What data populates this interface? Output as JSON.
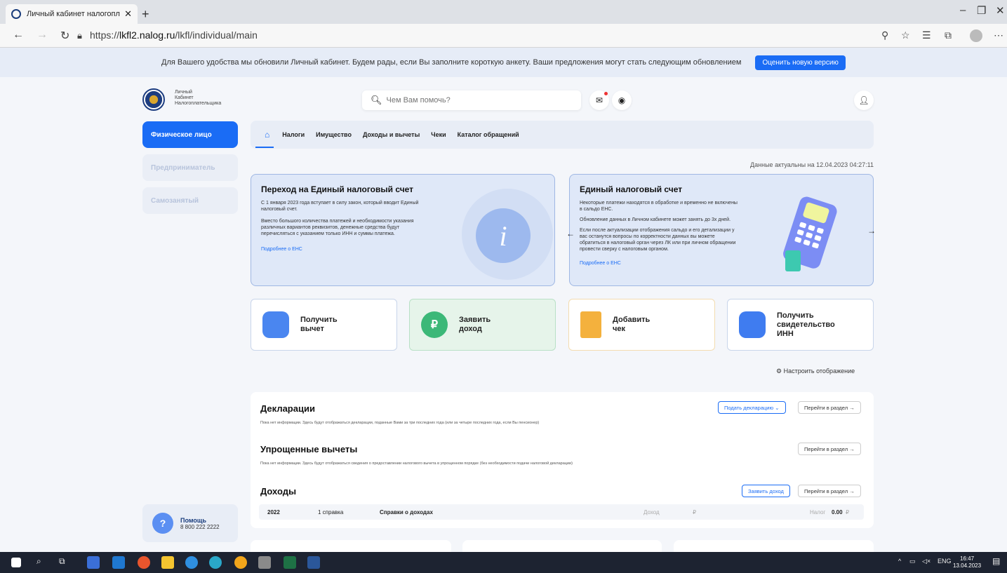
{
  "browser": {
    "tab_title": "Личный кабинет налогоплательщика",
    "url_prefix": "https://",
    "url_domain": "lkfl2.nalog.ru",
    "url_path": "/lkfl/individual/main"
  },
  "banner": {
    "text": "Для Вашего удобства мы обновили Личный кабинет. Будем рады, если Вы заполните короткую анкету. Ваши предложения могут стать следующим обновлением",
    "button": "Оценить новую версию"
  },
  "header": {
    "logo_line1": "Личный",
    "logo_line2": "Кабинет",
    "logo_line3": "Налогоплательщика",
    "search_placeholder": "Чем Вам помочь?"
  },
  "sidebar": {
    "items": [
      {
        "label": "Физическое лицо",
        "active": true
      },
      {
        "label": "Предприниматель",
        "active": false
      },
      {
        "label": "Самозанятый",
        "active": false
      }
    ],
    "help_title": "Помощь",
    "help_phone": "8 800 222 2222"
  },
  "menu": {
    "items": [
      "Налоги",
      "Имущество",
      "Доходы и вычеты",
      "Чеки",
      "Каталог обращений"
    ]
  },
  "updated": "Данные актуальны на 12.04.2023 04:27:11",
  "info_cards": [
    {
      "title": "Переход на Единый налоговый счет",
      "p1": "С 1 января 2023 года вступает в силу закон, который вводит Единый налоговый счет.",
      "p2": "Вместо большого количества платежей и необходимости указания различных вариантов реквизитов, денежные средства будут перечисляться с указанием только ИНН и суммы платежа.",
      "link": "Подробнее о ЕНС"
    },
    {
      "title": "Единый налоговый счет",
      "p1": "Некоторые платежи находятся в обработке и временно не включены в сальдо ЕНС.",
      "p2": "Обновление данных в Личном кабинете может занять до 3х дней.",
      "p3": "Если после актуализации отображения сальдо и его детализации у вас останутся вопросы по корректности данных вы можете обратиться в налоговый орган через ЛК или при личном обращении провести сверку с налоговым органом.",
      "link": "Подробнее о ЕНС"
    }
  ],
  "actions": [
    {
      "label": "Получить\nвычет",
      "color": "#4a86f0",
      "bg": "#ffffff",
      "border": "#c8d5ea"
    },
    {
      "label": "Заявить\nдоход",
      "color": "#3cb878",
      "bg": "#e6f4ea",
      "border": "#b9e0c6"
    },
    {
      "label": "Добавить\nчек",
      "color": "#f4b13d",
      "bg": "#ffffff",
      "border": "#f3dcb0"
    },
    {
      "label": "Получить\nсвидетельство\nИНН",
      "color": "#3f7cf0",
      "bg": "#ffffff",
      "border": "#c8d5ea"
    }
  ],
  "configure_label": "Настроить отображение",
  "sections": {
    "declarations": {
      "title": "Декларации",
      "note": "Пока нет информации. Здесь будут отображаться декларации, поданные Вами за три последних года (или за четыре последних года, если Вы пенсионер)",
      "btn_primary": "Подать декларацию ⌄",
      "btn_go": "Перейти в раздел →"
    },
    "simplified": {
      "title": "Упрощенные вычеты",
      "note": "Пока нет информации. Здесь будут отображаться сведения о предоставлении налогового вычета в упрощенном порядке (без необходимости подачи налоговой декларации)",
      "btn_go": "Перейти в раздел →"
    },
    "income": {
      "title": "Доходы",
      "btn_primary": "Заявить доход",
      "btn_go": "Перейти в раздел →",
      "row": {
        "year": "2022",
        "count": "1 справка",
        "type": "Справки о доходах",
        "income_label": "Доход",
        "income_currency": "₽",
        "tax_label": "Налог",
        "tax_value": "0.00",
        "tax_currency": "₽"
      }
    }
  },
  "taskbar": {
    "lang": "ENG",
    "time": "16:47",
    "date": "13.04.2023"
  },
  "colors": {
    "accent": "#1a6cf5",
    "taskbar": "#1d2331"
  }
}
